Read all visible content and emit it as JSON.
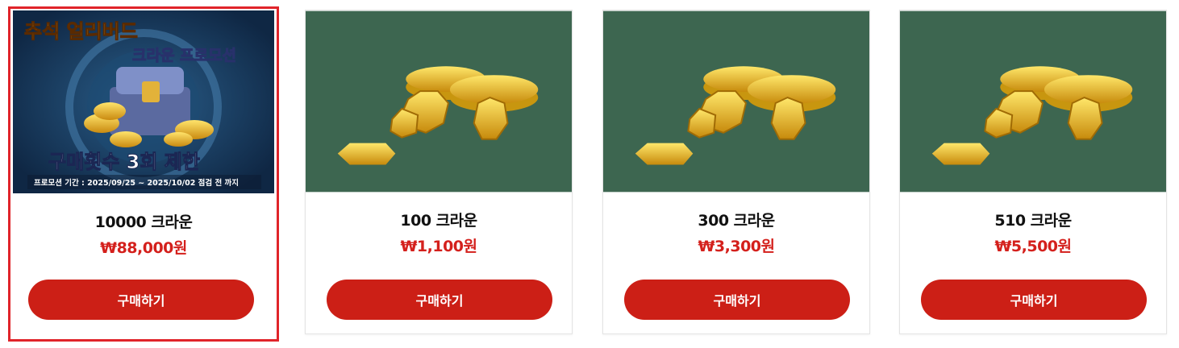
{
  "products": [
    {
      "name": "10000 크라운",
      "price": "₩88,000원",
      "button": "구매하기",
      "banner": {
        "title": "추석 얼리버드",
        "subtitle": "크라운 프로모션",
        "limit": "구매횟수 3회 제한",
        "period": "프로모션 기간 : 2025/09/25 ~ 2025/10/02 점검 전 까지"
      }
    },
    {
      "name": "100 크라운",
      "price": "₩1,100원",
      "button": "구매하기"
    },
    {
      "name": "300 크라운",
      "price": "₩3,300원",
      "button": "구매하기"
    },
    {
      "name": "510 크라운",
      "price": "₩5,500원",
      "button": "구매하기"
    }
  ],
  "colors": {
    "accent": "#cc1f16",
    "price": "#d4201c",
    "selected_border": "#e0242a",
    "coin_bg": "#3d6650",
    "banner_bg": "#17375a"
  }
}
